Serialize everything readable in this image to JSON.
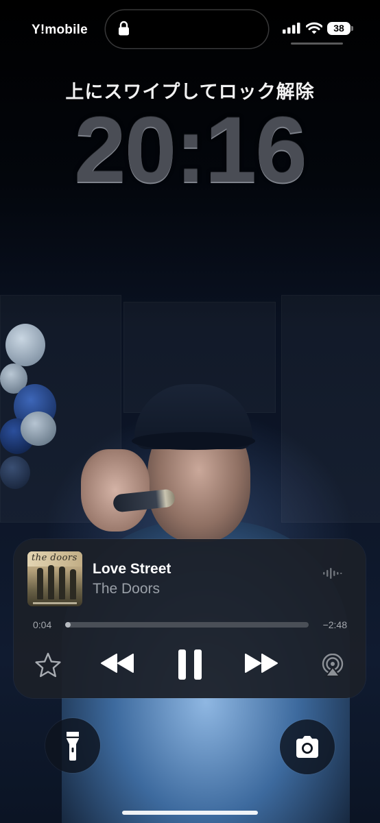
{
  "status_bar": {
    "carrier": "Y!mobile",
    "battery_percent": "38",
    "icons": [
      "lock-icon",
      "signal-icon",
      "wifi-icon",
      "battery-icon"
    ]
  },
  "lock_screen": {
    "unlock_hint": "上にスワイプしてロック解除",
    "time": "20:16"
  },
  "now_playing": {
    "title": "Love Street",
    "artist": "The Doors",
    "elapsed": "0:04",
    "remaining": "−2:48",
    "progress_fraction": 0.02,
    "artwork_text": "the doors",
    "controls": [
      "favorite-icon",
      "rewind-icon",
      "pause-icon",
      "fast-forward-icon",
      "airplay-icon"
    ]
  },
  "quick_actions": {
    "left": "flashlight-icon",
    "right": "camera-icon"
  },
  "colors": {
    "clock": "#4a4d55",
    "player_background": "#1c2028",
    "progress_fill": "#b6bac0",
    "secondary_text": "#9aa0a8"
  }
}
